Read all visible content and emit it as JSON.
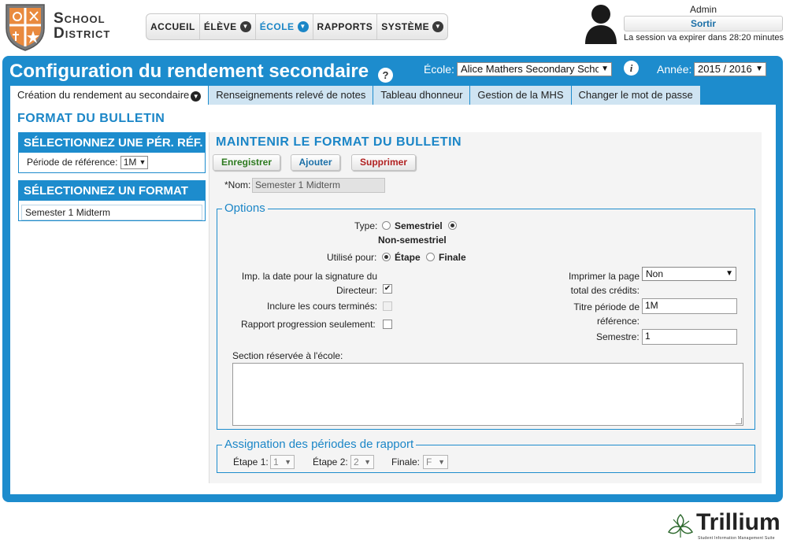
{
  "logo": {
    "line1": "School",
    "line2": "District"
  },
  "nav": {
    "items": [
      {
        "label": "ACCUEIL",
        "dropdown": false,
        "active": false
      },
      {
        "label": "ÉLÈVE",
        "dropdown": true,
        "active": false
      },
      {
        "label": "ÉCOLE",
        "dropdown": true,
        "active": true
      },
      {
        "label": "RAPPORTS",
        "dropdown": false,
        "active": false
      },
      {
        "label": "SYSTÈME",
        "dropdown": true,
        "active": false
      }
    ]
  },
  "user": {
    "name": "Admin",
    "logout_label": "Sortir",
    "session_text": "La session va expirer dans 28:20 minutes"
  },
  "page": {
    "title": "Configuration du rendement secondaire",
    "help_icon": "?",
    "info_icon": "i",
    "school_label": "École:",
    "school_value": "Alice Mathers Secondary School",
    "year_label": "Année:",
    "year_value": "2015 / 2016"
  },
  "tabs": [
    {
      "label": "Création du rendement au secondaire",
      "active": true,
      "dropdown": true
    },
    {
      "label": "Renseignements relevé de notes",
      "active": false
    },
    {
      "label": "Tableau dhonneur",
      "active": false
    },
    {
      "label": "Gestion de la MHS",
      "active": false
    },
    {
      "label": "Changer le mot de passe",
      "active": false
    }
  ],
  "section_title": "FORMAT DU BULLETIN",
  "left": {
    "period_box_title": "SÉLECTIONNEZ UNE PÉR. RÉF.",
    "period_label": "Période de référence:",
    "period_value": "1M",
    "format_box_title": "SÉLECTIONNEZ UN FORMAT",
    "formats": [
      "Semester 1 Midterm"
    ]
  },
  "right": {
    "title": "MAINTENIR LE FORMAT DU BULLETIN",
    "save_label": "Enregistrer",
    "add_label": "Ajouter",
    "delete_label": "Supprimer",
    "name_label": "*Nom:",
    "name_value": "Semester 1 Midterm",
    "options_legend": "Options",
    "type_label": "Type:",
    "type_semestrial": "Semestriel",
    "type_non_semestrial": "Non-semestriel",
    "type_selected": "Non-semestriel",
    "used_for_label": "Utilisé pour:",
    "used_for_stage": "Étape",
    "used_for_final": "Finale",
    "used_for_selected": "Étape",
    "print_date_label_1": "Imp. la date pour la signature du",
    "print_date_label_2": "Directeur:",
    "print_date_checked": true,
    "include_finished_label": "Inclure les cours terminés:",
    "include_finished_checked": false,
    "progress_only_label": "Rapport progression seulement:",
    "progress_only_checked": false,
    "print_credits_label_1": "Imprimer la page",
    "print_credits_label_2": "total des crédits:",
    "print_credits_value": "Non",
    "period_title_label_1": "Titre période de",
    "period_title_label_2": "référence:",
    "period_title_value": "1M",
    "semester_label": "Semestre:",
    "semester_value": "1",
    "school_section_label": "Section réservée à l'école:",
    "school_section_value": "",
    "assign_legend": "Assignation des périodes de rapport",
    "stage1_label": "Étape 1:",
    "stage1_value": "1",
    "stage2_label": "Étape 2:",
    "stage2_value": "2",
    "final_label": "Finale:",
    "final_value": "F"
  },
  "footer": {
    "brand": "Trillium",
    "tagline": "Student Information Management Suite"
  },
  "colors": {
    "primary": "#1d8ccd",
    "tab_inactive": "#cfe4f2",
    "save_text": "#2d7a1f",
    "add_text": "#1b6fa7",
    "delete_text": "#b02020"
  }
}
